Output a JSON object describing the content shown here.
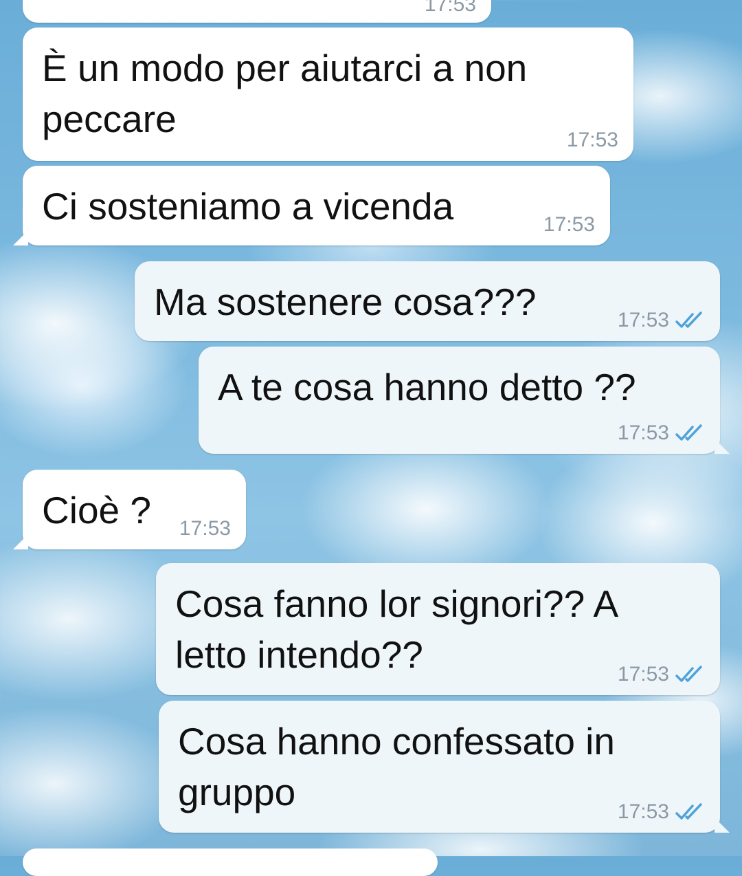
{
  "chat": {
    "messages": [
      {
        "id": "m0",
        "direction": "in",
        "text": "",
        "time": "17:53"
      },
      {
        "id": "m1",
        "direction": "in",
        "text": "È un modo per aiutarci a non\npeccare",
        "time": "17:53"
      },
      {
        "id": "m2",
        "direction": "in",
        "text": "Ci sosteniamo a vicenda",
        "time": "17:53"
      },
      {
        "id": "m3",
        "direction": "out",
        "text": "Ma sostenere cosa???",
        "time": "17:53",
        "status": "read"
      },
      {
        "id": "m4",
        "direction": "out",
        "text": "A te cosa hanno detto ??",
        "time": "17:53",
        "status": "read"
      },
      {
        "id": "m5",
        "direction": "in",
        "text": "Cioè ?",
        "time": "17:53"
      },
      {
        "id": "m6",
        "direction": "out",
        "text": "Cosa fanno lor signori?? A\nletto intendo??",
        "time": "17:53",
        "status": "read"
      },
      {
        "id": "m7",
        "direction": "out",
        "text": "Cosa hanno confessato in\ngruppo",
        "time": "17:53",
        "status": "read"
      }
    ]
  },
  "colors": {
    "incoming_bubble": "#ffffff",
    "outgoing_bubble": "#eef6fa",
    "read_ticks": "#4fa3d8",
    "timestamp": "#8b99a5"
  },
  "icons": {
    "read_receipt": "double-check-icon"
  }
}
